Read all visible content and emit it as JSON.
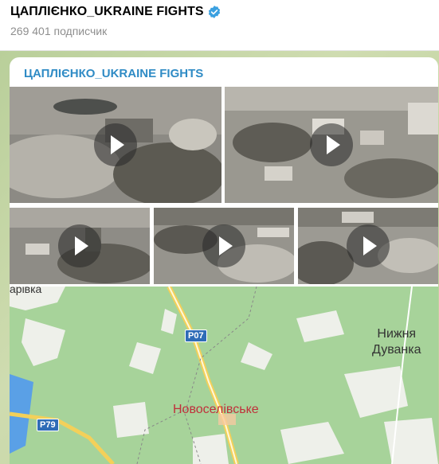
{
  "header": {
    "channel_name": "ЦАПЛІЄНКО_UKRAINE FIGHTS",
    "subscribers": "269 401 подписчик",
    "verified_icon": "verified-badge-icon"
  },
  "message": {
    "author": "ЦАПЛІЄНКО_UKRAINE FIGHTS",
    "videos": [
      {
        "name": "video-1",
        "icon": "play-icon"
      },
      {
        "name": "video-2",
        "icon": "play-icon"
      },
      {
        "name": "video-3",
        "icon": "play-icon"
      },
      {
        "name": "video-4",
        "icon": "play-icon"
      },
      {
        "name": "video-5",
        "icon": "play-icon"
      }
    ],
    "map": {
      "place_top_left": "арівка",
      "road_1": "P07",
      "road_2": "P79",
      "village_1_line1": "Нижня",
      "village_1_line2": "Дуванка",
      "highlighted_town": "Новоселівське"
    }
  },
  "colors": {
    "accent": "#2f8bc5",
    "verified": "#3aa0e0",
    "map_green": "#a7d39a",
    "road_badge": "#2f6cb7",
    "town_label": "#c0303b"
  }
}
